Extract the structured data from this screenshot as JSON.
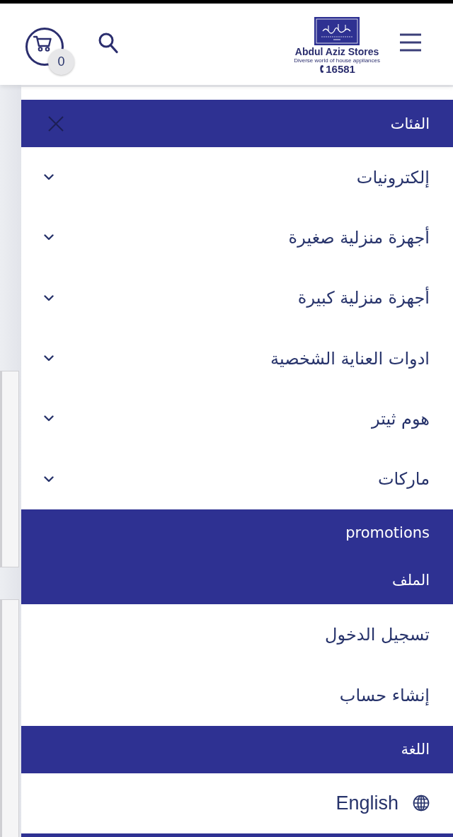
{
  "header": {
    "cart_count": "0",
    "brand": {
      "name": "Abdul Aziz Stores",
      "tagline": "Diverse world of house appliances",
      "phone": "16581"
    }
  },
  "menu": {
    "rows": [
      {
        "kind": "heading",
        "title": "الفئات",
        "closable": true
      },
      {
        "kind": "category",
        "label": "إلكترونيات",
        "expanded": false
      },
      {
        "kind": "category",
        "label": "أجهزة منزلية صغيرة",
        "expanded": false
      },
      {
        "kind": "category",
        "label": "أجهزة منزلية كبيرة",
        "expanded": false
      },
      {
        "kind": "category",
        "label": "ادوات العناية الشخصية",
        "expanded": false
      },
      {
        "kind": "category",
        "label": "هوم ثيتر",
        "expanded": false
      },
      {
        "kind": "category",
        "label": "ماركات",
        "expanded": false
      },
      {
        "kind": "heading",
        "title": "promotions",
        "closable": false
      },
      {
        "kind": "heading",
        "title": "الملف",
        "closable": false
      },
      {
        "kind": "link",
        "label": "تسجيل الدخول"
      },
      {
        "kind": "link",
        "label": "إنشاء حساب"
      },
      {
        "kind": "heading",
        "title": "اللغة",
        "closable": false
      },
      {
        "kind": "language",
        "label": "English"
      }
    ]
  }
}
